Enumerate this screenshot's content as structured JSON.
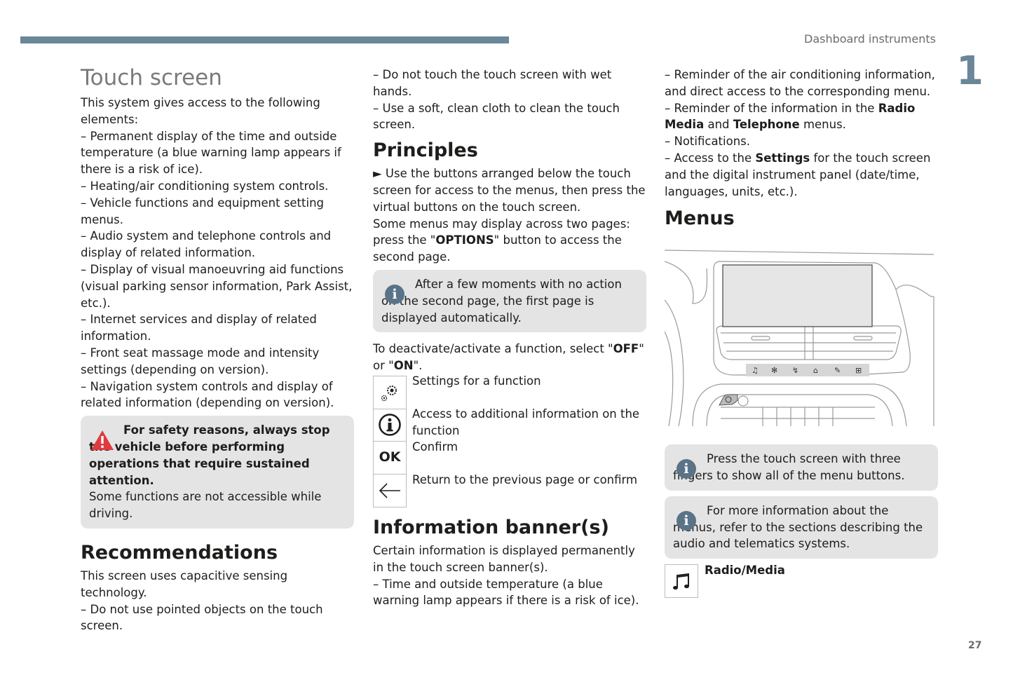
{
  "header": {
    "section_title": "Dashboard instruments",
    "chapter_number": "1"
  },
  "footer": {
    "page_number": "27"
  },
  "col1": {
    "title": "Touch screen",
    "intro": "This system gives access to the following elements:",
    "items": [
      "–  Permanent display of the time and outside temperature (a blue warning lamp appears if there is a risk of ice).",
      "–  Heating/air conditioning system controls.",
      "–  Vehicle functions and equipment setting menus.",
      "–  Audio system and telephone controls and display of related information.",
      "–  Display of visual manoeuvring aid functions (visual parking sensor information, Park Assist, etc.).",
      "–  Internet services and display of related information.",
      "–  Front seat massage mode and intensity settings (depending on version).",
      "–  Navigation system controls and display of related information (depending on version)."
    ],
    "warning": {
      "bold": "For safety reasons, always stop the vehicle before performing operations that require sustained attention.",
      "text": "Some functions are not accessible while driving."
    },
    "rec_title": "Recommendations",
    "rec_items": [
      "This screen uses capacitive sensing technology.",
      "–  Do not use pointed objects on the touch screen."
    ]
  },
  "col2": {
    "items": [
      "–  Do not touch the touch screen with wet hands.",
      "–  Use a soft, clean cloth to clean the touch screen."
    ],
    "principles_title": "Principles",
    "principles_p1": "► Use the buttons arranged below the touch screen for access to the menus, then press the virtual buttons on the touch screen.",
    "principles_p2_a": "Some menus may display across two pages: press the \"",
    "principles_p2_bold": "OPTIONS",
    "principles_p2_b": "\" button to access the second page.",
    "info_box": "After a few moments with no action on the second page, the first page is displayed automatically.",
    "deact_a": "To deactivate/activate a function, select \"",
    "deact_off": "OFF",
    "deact_b": "\" or \"",
    "deact_on": "ON",
    "deact_c": "\".",
    "icons": [
      {
        "icon": "settings-gears-icon",
        "desc": "Settings for a function"
      },
      {
        "icon": "info-circle-icon",
        "desc": "Access to additional information on the function"
      },
      {
        "icon": "ok-icon",
        "label": "OK",
        "desc": "Confirm"
      },
      {
        "icon": "back-arrow-icon",
        "desc": "Return to the previous page or confirm"
      }
    ],
    "banner_title": "Information banner(s)",
    "banner_p": "Certain information is displayed permanently in the touch screen banner(s).",
    "banner_item": "–  Time and outside temperature (a blue warning lamp appears if there is a risk of ice)."
  },
  "col3": {
    "item1": "–  Reminder of the air conditioning information, and direct access to the corresponding menu.",
    "item2_a": "–  Reminder of the information in the ",
    "item2_bold1": "Radio Media",
    "item2_mid": " and ",
    "item2_bold2": "Telephone",
    "item2_b": " menus.",
    "item3": "–  Notifications.",
    "item4_a": "–  Access to the ",
    "item4_bold": "Settings",
    "item4_b": " for the touch screen and the digital instrument panel (date/time, languages, units, etc.).",
    "menus_title": "Menus",
    "info1": "Press the touch screen with three fingers to show all of the menu buttons.",
    "info2": "For more information about the menus, refer to the sections describing the audio and telematics systems.",
    "radio_label": "Radio/Media"
  },
  "colors": {
    "accent": "#6a8699",
    "info_icon": "#5a7387",
    "box_bg": "#e4e4e4",
    "warning_red": "#e03a3e"
  }
}
